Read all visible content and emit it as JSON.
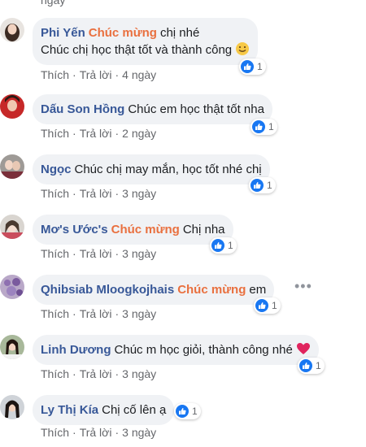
{
  "top_meta": {
    "time": "ngày"
  },
  "actions": {
    "like": "Thích",
    "reply": "Trả lời"
  },
  "colors": {
    "author": "#385898",
    "tag": "#e9703f",
    "like": "#1877f2"
  },
  "comments": [
    {
      "author": "Phi Yến",
      "tag": "Chúc mừng",
      "text": "chị nhé",
      "text2": "Chúc chị học thật tốt và thành công",
      "emoji": "smile-emoji",
      "likes": "1",
      "time": "4 ngày"
    },
    {
      "author": "Dấu Son Hồng",
      "tag": "",
      "text": "Chúc em học thật tốt nha",
      "likes": "1",
      "time": "2 ngày"
    },
    {
      "author": "Ngọc",
      "tag": "",
      "text": "Chúc chị may mắn, học tốt nhé chị",
      "likes": "1",
      "time": "3 ngày"
    },
    {
      "author": "Mơ's Ước's",
      "tag": "Chúc mừng",
      "text": "Chị nha",
      "likes": "1",
      "time": "3 ngày"
    },
    {
      "author": "Qhibsiab Mloogkojhais",
      "tag": "Chúc mừng",
      "text": "em",
      "likes": "1",
      "time": "3 ngày"
    },
    {
      "author": "Linh Dương",
      "tag": "",
      "text": "Chúc m học giỏi, thành công nhé",
      "emoji": "heart-emoji",
      "likes": "1",
      "time": "3 ngày"
    },
    {
      "author": "Ly Thị Kía",
      "tag": "",
      "text": "Chị cố lên ạ",
      "likes": "1",
      "time": "3 ngày"
    }
  ]
}
